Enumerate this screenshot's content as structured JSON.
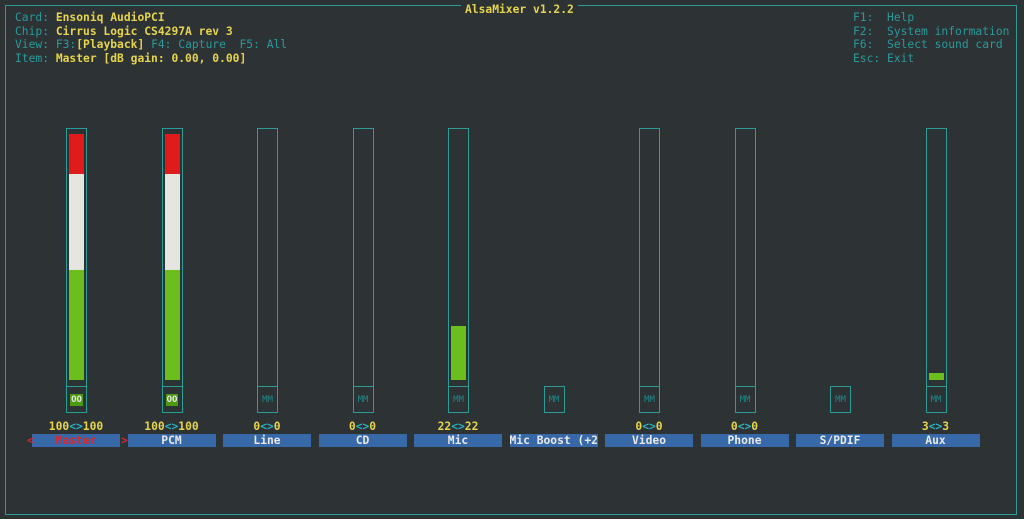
{
  "title": "AlsaMixer v1.2.2",
  "info": {
    "card_label": "Card:",
    "card": "Ensoniq AudioPCI",
    "chip_label": "Chip:",
    "chip": "Cirrus Logic CS4297A rev 3",
    "view_label": "View:",
    "view_f3": "F3:",
    "view_playback": "[Playback]",
    "view_f4": "F4: Capture",
    "view_f5": "F5: All",
    "item_label": "Item:",
    "item": "Master [dB gain: 0.00, 0.00]"
  },
  "help": [
    {
      "key": "F1:",
      "text": "Help"
    },
    {
      "key": "F2:",
      "text": "System information"
    },
    {
      "key": "F6:",
      "text": "Select sound card"
    },
    {
      "key": "Esc:",
      "text": "Exit"
    }
  ],
  "colors": {
    "border": "#2c9c96",
    "high": "#e01b1b",
    "mid": "#e6e6e0",
    "low": "#6abf1e",
    "label_bg": "#3768a8",
    "value": "#e6d44c"
  },
  "controls": [
    {
      "name": "Master",
      "level": 100,
      "left": "100",
      "right": "100",
      "mute": "OO",
      "unmuted": true,
      "has_slider": true,
      "selected": true
    },
    {
      "name": "PCM",
      "level": 100,
      "left": "100",
      "right": "100",
      "mute": "OO",
      "unmuted": true,
      "has_slider": true
    },
    {
      "name": "Line",
      "level": 0,
      "left": "0",
      "right": "0",
      "mute": "MM",
      "has_slider": true
    },
    {
      "name": "CD",
      "level": 0,
      "left": "0",
      "right": "0",
      "mute": "MM",
      "has_slider": true
    },
    {
      "name": "Mic",
      "level": 22,
      "left": "22",
      "right": "22",
      "mute": "MM",
      "has_slider": true
    },
    {
      "name": "Mic Boost (+2",
      "mute": "MM",
      "has_slider": false
    },
    {
      "name": "Video",
      "level": 0,
      "left": "0",
      "right": "0",
      "mute": "MM",
      "has_slider": true
    },
    {
      "name": "Phone",
      "level": 0,
      "left": "0",
      "right": "0",
      "mute": "MM",
      "has_slider": true
    },
    {
      "name": "S/PDIF",
      "mute": "MM",
      "has_slider": false
    },
    {
      "name": "Aux",
      "level": 3,
      "left": "3",
      "right": "3",
      "mute": "MM",
      "has_slider": true
    }
  ],
  "value_separator": "<>",
  "select_left": "<",
  "select_right": ">"
}
